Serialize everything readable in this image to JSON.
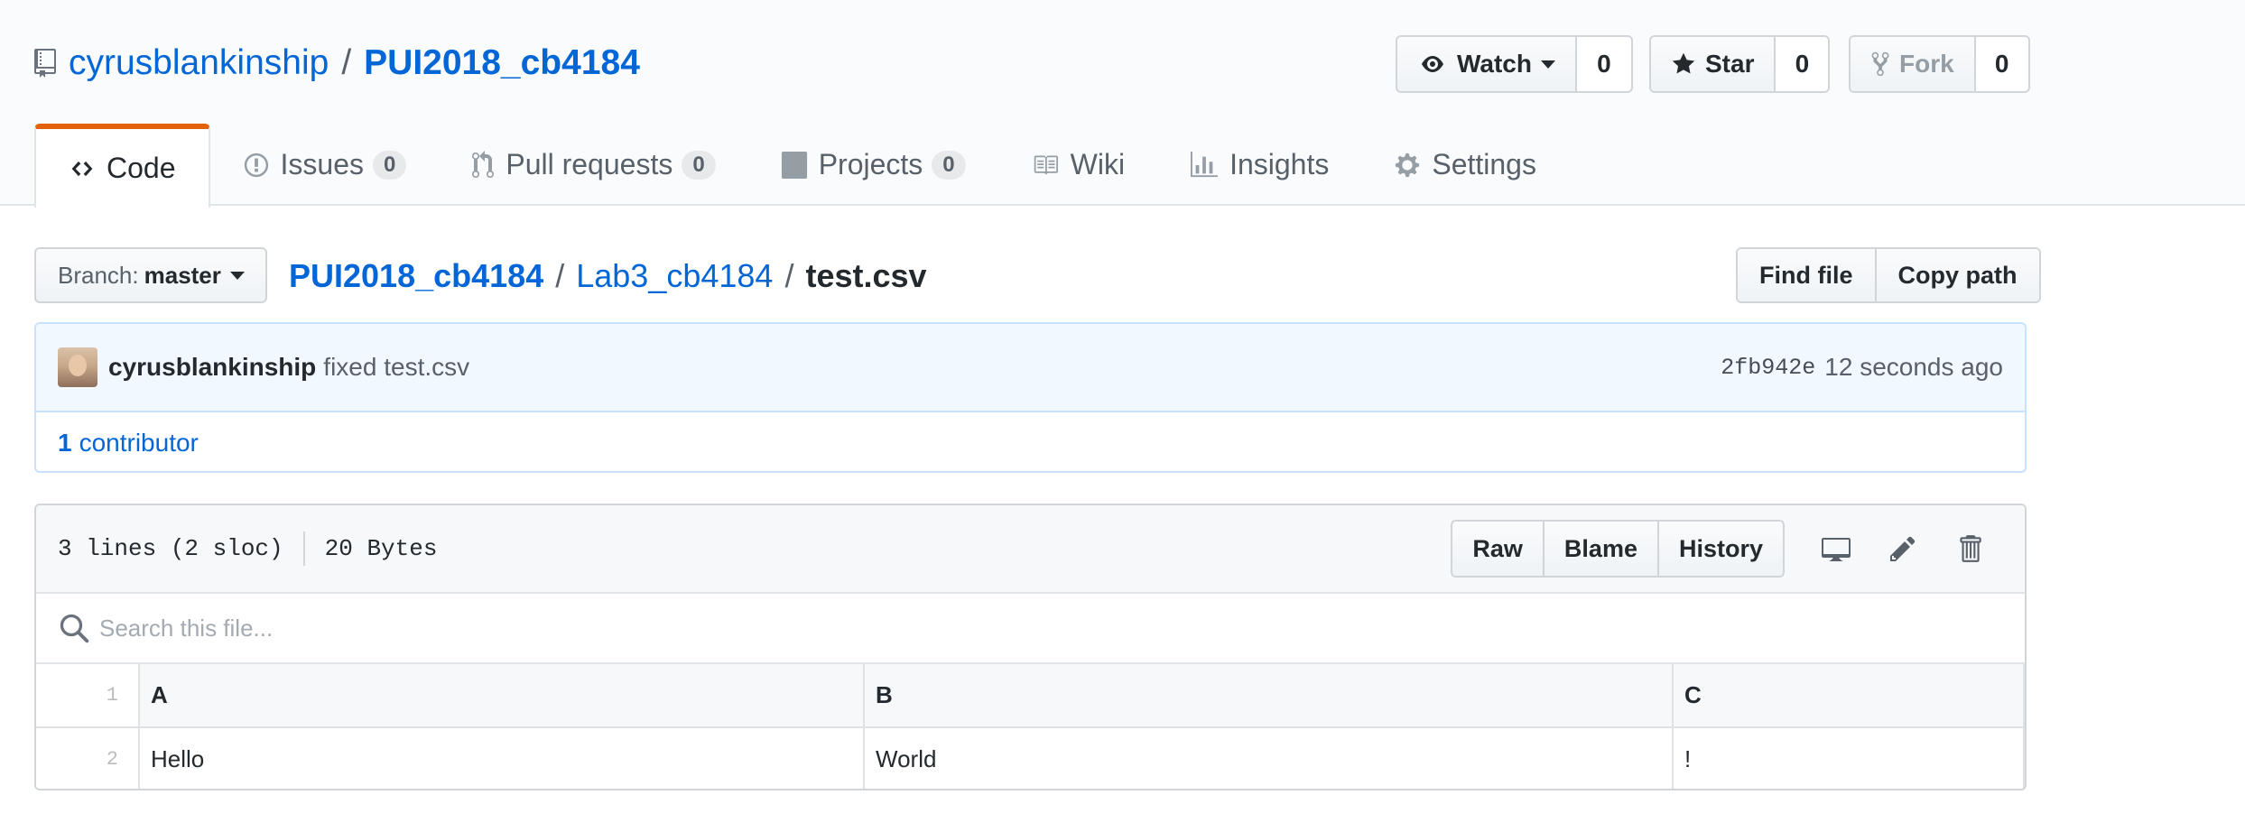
{
  "repo": {
    "owner": "cyrusblankinship",
    "separator": "/",
    "name": "PUI2018_cb4184"
  },
  "actions": {
    "watch": {
      "label": "Watch",
      "count": "0"
    },
    "star": {
      "label": "Star",
      "count": "0"
    },
    "fork": {
      "label": "Fork",
      "count": "0"
    }
  },
  "tabs": [
    {
      "label": "Code",
      "icon": "code-icon",
      "selected": true
    },
    {
      "label": "Issues",
      "counter": "0",
      "icon": "issue-icon"
    },
    {
      "label": "Pull requests",
      "counter": "0",
      "icon": "pull-request-icon"
    },
    {
      "label": "Projects",
      "counter": "0",
      "icon": "project-icon"
    },
    {
      "label": "Wiki",
      "icon": "book-icon"
    },
    {
      "label": "Insights",
      "icon": "graph-icon"
    },
    {
      "label": "Settings",
      "icon": "gear-icon"
    }
  ],
  "branch": {
    "label": "Branch:",
    "value": "master"
  },
  "breadcrumb": {
    "root": "PUI2018_cb4184",
    "folder": "Lab3_cb4184",
    "file": "test.csv",
    "sep": "/"
  },
  "file_nav": {
    "find_file": "Find file",
    "copy_path": "Copy path"
  },
  "commit": {
    "author": "cyrusblankinship",
    "message": "fixed test.csv",
    "sha": "2fb942e",
    "time": "12 seconds ago"
  },
  "contributors": {
    "count": "1",
    "label": "contributor"
  },
  "file": {
    "lines": "3 lines (2 sloc)",
    "size": "20 Bytes",
    "buttons": {
      "raw": "Raw",
      "blame": "Blame",
      "history": "History"
    },
    "search_placeholder": "Search this file..."
  },
  "csv": {
    "header": {
      "line": "1",
      "cells": [
        "A",
        "B",
        "C"
      ]
    },
    "rows": [
      {
        "line": "2",
        "cells": [
          "Hello",
          "World",
          "!"
        ]
      }
    ]
  },
  "colors": {
    "link": "#0366d6",
    "selected_tab_accent": "#e36209",
    "commit_bg": "#f1f8ff"
  }
}
